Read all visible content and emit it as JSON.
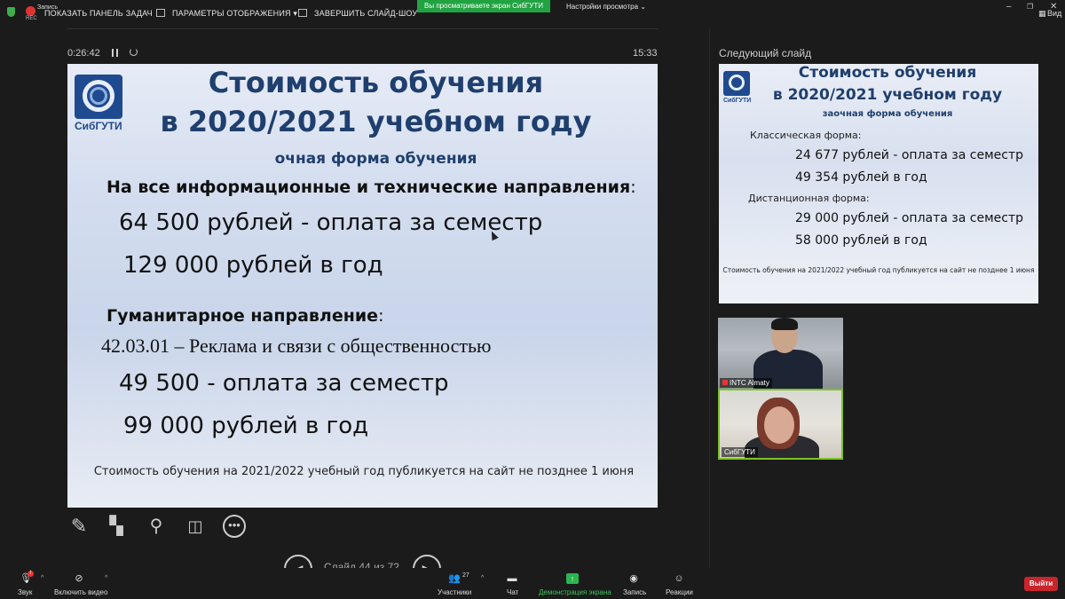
{
  "topbar": {
    "rec_label": "Запись",
    "rec_sub": "REC",
    "show_taskbar": "ПОКАЗАТЬ ПАНЕЛЬ ЗАДАЧ",
    "display_settings": "ПАРАМЕТРЫ ОТОБРАЖЕНИЯ ▾",
    "end_slideshow": "ЗАВЕРШИТЬ СЛАЙД-ШОУ",
    "viewing_banner": "Вы просматриваете экран СибГУТИ",
    "view_settings": "Настройки просмотра ⌄",
    "view_label": "Вид"
  },
  "presenter": {
    "timer": "0:26:42",
    "clock": "15:33",
    "slide_counter": "Слайд 44 из 72"
  },
  "slide": {
    "logo_text": "СибГУТИ",
    "title_line1": "Стоимость обучения",
    "title_line2": "в 2020/2021 учебном году",
    "subtitle": "очная форма обучения",
    "heading1": "На все информационные и технические направления",
    "heading1_colon": ":",
    "price1": "64 500 рублей - оплата за семестр",
    "price2": "129 000 рублей в год",
    "heading2": "Гуманитарное направление",
    "heading2_colon": ":",
    "program": "42.03.01 – Реклама и связи с общественностью",
    "price3": "49 500  - оплата за семестр",
    "price4": "99 000 рублей в год",
    "note": "Стоимость обучения на 2021/2022 учебный год публикуется на сайт не позднее 1 июня"
  },
  "next_slide": {
    "label": "Следующий слайд",
    "logo_text": "СибГУТИ",
    "title_line1": "Стоимость обучения",
    "title_line2": "в 2020/2021 учебном году",
    "subtitle": "заочная форма обучения",
    "classic_label": "Классическая форма:",
    "classic_price1": "24 677 рублей - оплата за семестр",
    "classic_price2": "49 354 рублей в год",
    "distance_label": "Дистанционная форма:",
    "distance_price1": "29 000 рублей - оплата за семестр",
    "distance_price2": "58 000 рублей в год",
    "note": "Стоимость обучения на 2021/2022 учебный год публикуется на сайт не позднее 1 июня"
  },
  "participants": [
    {
      "name": "INTC Almaty",
      "muted": true
    },
    {
      "name": "СибГУТИ",
      "muted": false
    }
  ],
  "bottombar": {
    "audio": "Звук",
    "video": "Включить видео",
    "participants": "Участники",
    "participants_count": "27",
    "chat": "Чат",
    "share": "Демонстрация экрана",
    "record": "Запись",
    "reactions": "Реакции",
    "exit": "Выйти"
  },
  "colors": {
    "accent_green": "#22a342",
    "exit_red": "#c9252c",
    "slide_title": "#1f3f6e"
  }
}
